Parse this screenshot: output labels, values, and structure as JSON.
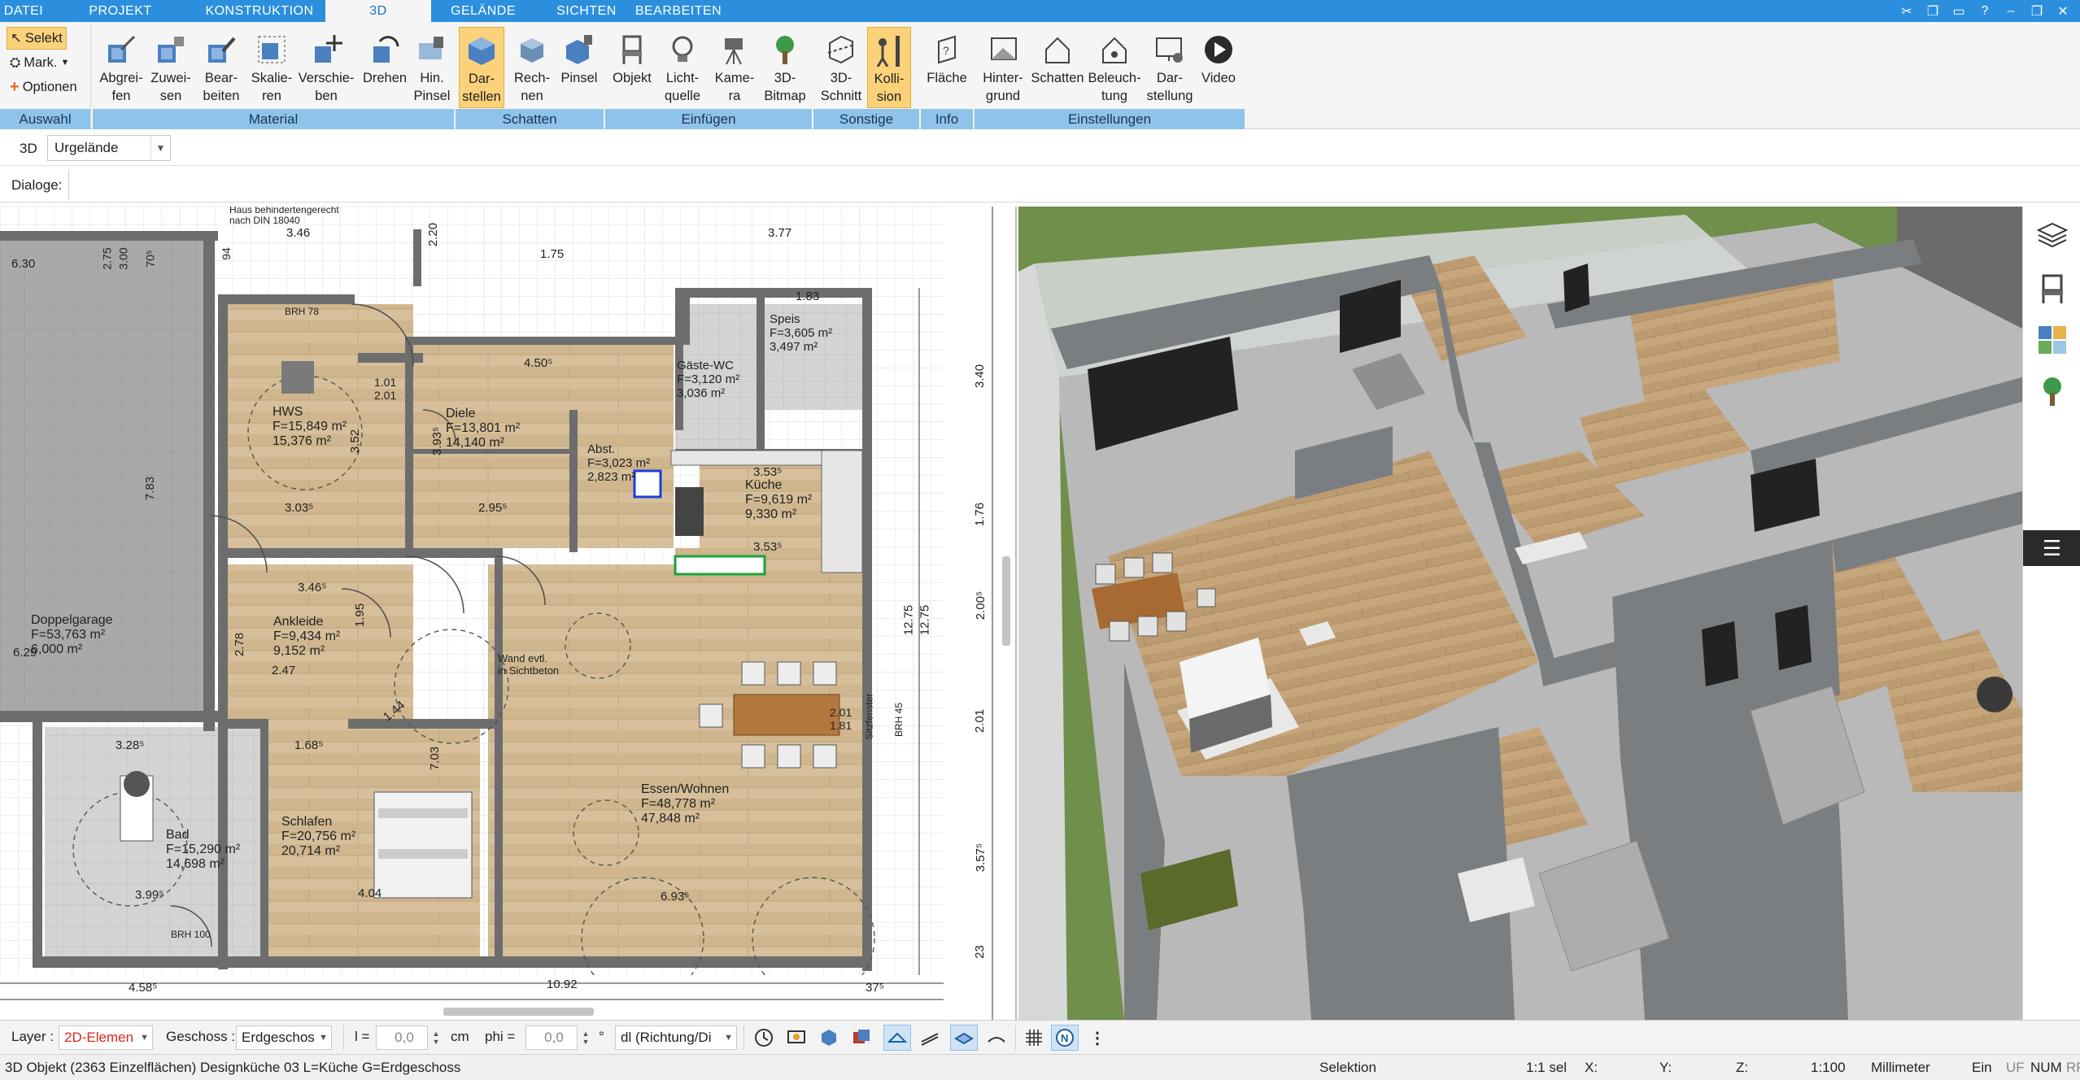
{
  "menu": {
    "tabs": [
      "DATEI",
      "PROJEKT",
      "KONSTRUKTION",
      "3D",
      "GELÄNDE",
      "SICHTEN",
      "BEARBEITEN"
    ],
    "active_tab": "3D"
  },
  "ribbon": {
    "auswahl": {
      "label": "Auswahl",
      "selekt": "Selekt",
      "mark": "Mark.",
      "optionen": "Optionen"
    },
    "material": {
      "label": "Material",
      "buttons": [
        "Abgrei-\nfen",
        "Zuwei-\nsen",
        "Bear-\nbeiten",
        "Skalie-\nren",
        "Verschie-\nben",
        "Drehen",
        "Hin.\nPinsel"
      ]
    },
    "schatten": {
      "label": "Schatten",
      "buttons": [
        "Dar-\nstellen",
        "Rech-\nnen",
        "Pinsel"
      ]
    },
    "einfuegen": {
      "label": "Einfügen",
      "buttons": [
        "Objekt",
        "Licht-\nquelle",
        "Kame-\nra",
        "3D-\nBitmap"
      ]
    },
    "sonstige": {
      "label": "Sonstige",
      "buttons": [
        "3D-\nSchnitt",
        "Kolli-\nsion"
      ]
    },
    "info": {
      "label": "Info",
      "buttons": [
        "Fläche"
      ]
    },
    "einstellungen": {
      "label": "Einstellungen",
      "buttons": [
        "Hinter-\ngrund",
        "Schatten",
        "Beleuch-\ntung",
        "Dar-\nstellung",
        "Video"
      ]
    }
  },
  "view_row": {
    "mode": "3D",
    "terrain_value": "Urgelände"
  },
  "dialog_row": {
    "label": "Dialoge:"
  },
  "plan": {
    "rooms": [
      {
        "name": "HWS",
        "area1": "F=15,849 m²",
        "area2": "15,376 m²"
      },
      {
        "name": "Diele",
        "area1": "F=13,801 m²",
        "area2": "14,140 m²"
      },
      {
        "name": "Abst.",
        "area1": "F=3,023 m²",
        "area2": "2,823 m²"
      },
      {
        "name": "Gäste-WC",
        "area1": "F=3,120 m²",
        "area2": "3,036 m²"
      },
      {
        "name": "Speis",
        "area1": "F=3,605 m²",
        "area2": "3,497 m²"
      },
      {
        "name": "Küche",
        "area1": "F=9,619 m²",
        "area2": "9,330 m²"
      },
      {
        "name": "Doppelgarage",
        "area1": "F=53,763 m²",
        "area2": "6,000 m²"
      },
      {
        "name": "Ankleide",
        "area1": "F=9,434 m²",
        "area2": "9,152 m²"
      },
      {
        "name": "Schlafen",
        "area1": "F=20,756 m²",
        "area2": "20,714 m²"
      },
      {
        "name": "Bad",
        "area1": "F=15,290 m²",
        "area2": "14,698 m²"
      },
      {
        "name": "Essen/Wohnen",
        "area1": "F=48,778 m²",
        "area2": "47,848 m²"
      }
    ],
    "notes": {
      "barrier_free": "Haus behindertengerecht",
      "din": "nach DIN 18040",
      "wall_note1": "Wand evtl.",
      "wall_note2": "in Sichtbeton"
    },
    "dims": {
      "d1": "3.46",
      "d2": "6.30",
      "d3": "2.75",
      "d4": "3.00",
      "d5": "70⁵",
      "d6": "94",
      "d7": "3.77",
      "d8": "1.83",
      "d9": "3.40",
      "d10": "1.76",
      "d11": "2.00⁵",
      "d12": "2.01",
      "d13": "3.57⁵",
      "d14": "23",
      "d15": "12.75",
      "d16": "12.75",
      "d17": "7.83",
      "d18": "4.50⁵",
      "d19": "2.95⁵",
      "d20": "3.03⁵",
      "d21": "3.93⁵",
      "d22": "3.52",
      "d23": "3.46⁵",
      "d24": "2.78",
      "d25": "2.47",
      "d26": "1.95",
      "d27": "7.03",
      "d28": "1.68⁵",
      "d29": "3.28⁵",
      "d30": "3.99⁵",
      "d31": "4.04",
      "d32": "6.93⁵",
      "d33": "10.92",
      "d34": "4.58⁵",
      "d35": "3.53⁵",
      "d36": "3.53⁵",
      "d37": "1.01",
      "d38": "2.01",
      "d39": "BRH 78",
      "d40": "BRH 100",
      "d41": "BRH 45",
      "d42": "Sitzfenster",
      "d43": "2.01",
      "d44": "1.81",
      "d45": "37⁵",
      "d46": "1.75",
      "d47": "2.20",
      "d48": "6.29",
      "d49": "1.44"
    }
  },
  "bottom": {
    "layer_label": "Layer :",
    "layer_value": "2D-Elemen",
    "floor_label": "Geschoss :",
    "floor_value": "Erdgeschos",
    "l_label": "l =",
    "l_value": "0,0",
    "l_unit": "cm",
    "phi_label": "phi =",
    "phi_value": "0,0",
    "phi_unit": "°",
    "dir_value": "dl (Richtung/Di"
  },
  "status": {
    "left": "3D Objekt (2363 Einzelflächen) Designküche 03 L=Küche G=Erdgeschoss",
    "mode": "Selektion",
    "sel": "1:1 sel",
    "x": "X:",
    "y": "Y:",
    "z": "Z:",
    "scale": "1:100",
    "unit": "Millimeter",
    "ein": "Ein",
    "uf": "UF",
    "num": "NUM",
    "rf": "RF"
  },
  "colors": {
    "menubar": "#2b8fdd",
    "ribbon_group_label": "#8ec3ec",
    "highlight": "#fbd27a",
    "floor_wood": "#c9ab82",
    "wall_gray": "#777a7c"
  }
}
